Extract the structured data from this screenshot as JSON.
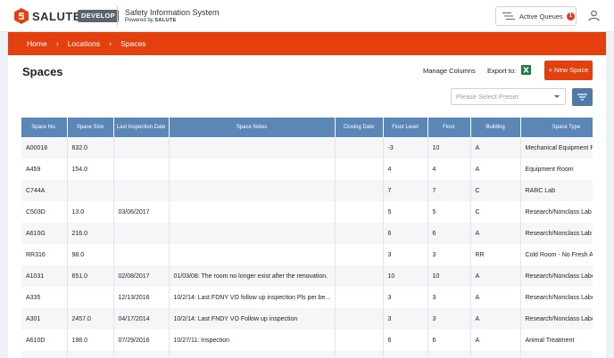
{
  "header": {
    "logo_text": "SALUTE",
    "env_badge": "DEVELOP",
    "app_title": "Safety Information System",
    "app_subtitle_prefix": "Powered by",
    "app_subtitle_brand": "SALUTE",
    "queues_label": "Active Queues",
    "queues_count": "1"
  },
  "breadcrumb": [
    "Home",
    "Locations",
    "Spaces"
  ],
  "page": {
    "title": "Spaces",
    "manage_columns": "Manage Columns",
    "export_to": "Export to:",
    "new_space": "+ New Space",
    "preset_placeholder": "Please Select Preset"
  },
  "table": {
    "columns": [
      "Space No.",
      "Space Size",
      "Last Inspection Date",
      "Space Notes",
      "Closing Date",
      "Floor Level",
      "Floor",
      "Building",
      "Space Type"
    ],
    "rows": [
      [
        "A00018",
        "632.0",
        "",
        "",
        "",
        "-3",
        "10",
        "A",
        "Mechanical Equipment R"
      ],
      [
        "A459",
        "154.0",
        "",
        "",
        "",
        "4",
        "4",
        "A",
        "Equipment Room"
      ],
      [
        "C744A",
        "",
        "",
        "",
        "",
        "7",
        "7",
        "C",
        "RARC Lab"
      ],
      [
        "C503D",
        "13.0",
        "03/06/2017",
        "",
        "",
        "5",
        "5",
        "C",
        "Research/Nonclass Lab S"
      ],
      [
        "A610G",
        "216.0",
        "",
        "",
        "",
        "6",
        "6",
        "A",
        "Research/Nonclass Lab S"
      ],
      [
        "RR316",
        "98.0",
        "",
        "",
        "",
        "3",
        "3",
        "RR",
        "Cold Room - No Fresh Ai"
      ],
      [
        "A1031",
        "651.0",
        "02/08/2017",
        "01/03/08: The room no longer exist after the renovation.",
        "",
        "10",
        "10",
        "A",
        "Research/Nonclass Labo"
      ],
      [
        "A335",
        "",
        "12/13/2016",
        "10/2/14: Last FDNY VO follow up inspection Pls per be...",
        "",
        "3",
        "3",
        "A",
        "Research/Nonclass Labo"
      ],
      [
        "A301",
        "2457.0",
        "04/17/2014",
        "10/2/14: Last FNDY VO Follow up inspection",
        "",
        "3",
        "3",
        "A",
        "Research/Nonclass Labo"
      ],
      [
        "A610D",
        "198.0",
        "07/29/2016",
        "10/27/11: Inspection",
        "",
        "6",
        "6",
        "A",
        "Animal Treatment"
      ],
      [
        "",
        "",
        "",
        "",
        "",
        "",
        "",
        "",
        ""
      ]
    ]
  },
  "colors": {
    "brand_orange": "#e4400f",
    "table_header": "#5b87b6",
    "badge_red": "#e23a2d"
  }
}
